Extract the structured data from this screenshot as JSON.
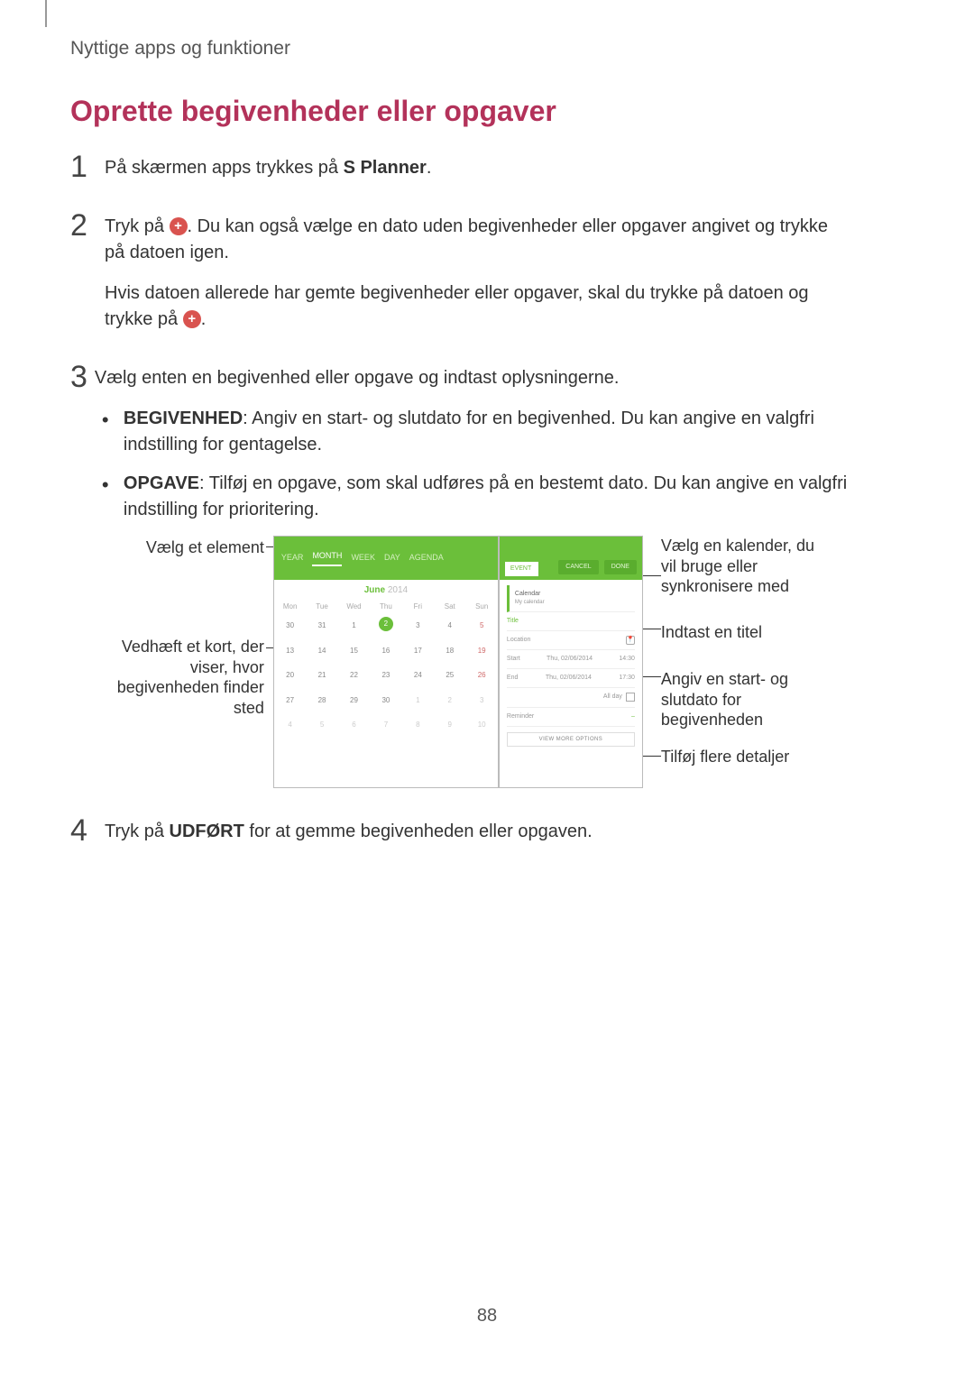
{
  "header": "Nyttige apps og funktioner",
  "title": "Oprette begivenheder eller opgaver",
  "page_number": "88",
  "steps": {
    "s1": {
      "num": "1",
      "pre": "På skærmen apps trykkes på ",
      "bold": "S Planner",
      "post": "."
    },
    "s2": {
      "num": "2",
      "p1a": "Tryk på ",
      "p1b": ". Du kan også vælge en dato uden begivenheder eller opgaver angivet og trykke på datoen igen.",
      "p2a": "Hvis datoen allerede har gemte begivenheder eller opgaver, skal du trykke på datoen og trykke på ",
      "p2b": "."
    },
    "s3": {
      "num": "3",
      "lead": "Vælg enten en begivenhed eller opgave og indtast oplysningerne.",
      "b1_bold": "BEGIVENHED",
      "b1_rest": ": Angiv en start- og slutdato for en begivenhed. Du kan angive en valgfri indstilling for gentagelse.",
      "b2_bold": "OPGAVE",
      "b2_rest": ": Tilføj en opgave, som skal udføres på en bestemt dato. Du kan angive en valgfri indstilling for prioritering."
    },
    "s4": {
      "num": "4",
      "pre": "Tryk på ",
      "bold": "UDFØRT",
      "post": " for at gemme begivenheden eller opgaven."
    }
  },
  "callouts": {
    "left1": "Vælg et element",
    "left2": "Vedhæft et kort, der viser, hvor begivenheden finder sted",
    "right1": "Vælg en kalender, du vil bruge eller synkronisere med",
    "right2": "Indtast en titel",
    "right3": "Angiv en start- og slutdato for begivenheden",
    "right4": "Tilføj flere detaljer"
  },
  "mock": {
    "tabs": [
      "YEAR",
      "MONTH",
      "WEEK",
      "DAY",
      "AGENDA"
    ],
    "month": "June",
    "year": "2014",
    "weekdays": [
      "Mon",
      "Tue",
      "Wed",
      "Thu",
      "Fri",
      "Sat",
      "Sun"
    ],
    "days": [
      "30",
      "31",
      "1",
      "2",
      "3",
      "4",
      "5",
      "13",
      "14",
      "15",
      "16",
      "17",
      "18",
      "19",
      "20",
      "21",
      "22",
      "23",
      "24",
      "25",
      "26",
      "27",
      "28",
      "29",
      "30",
      "1",
      "2",
      "3",
      "4",
      "5",
      "6",
      "7",
      "8",
      "9",
      "10"
    ],
    "right_tab_selected": "EVENT",
    "cancel": "CANCEL",
    "done": "DONE",
    "calendar_label": "Calendar",
    "calendar_sub": "My calendar",
    "title_placeholder": "Title",
    "location_label": "Location",
    "start_label": "Start",
    "end_label": "End",
    "start_val": "Thu, 02/06/2014",
    "end_val": "Thu, 02/06/2014",
    "start_time": "14:30",
    "end_time": "17:30",
    "allday_label": "All day",
    "reminder_label": "Reminder",
    "view_more": "VIEW MORE OPTIONS"
  }
}
